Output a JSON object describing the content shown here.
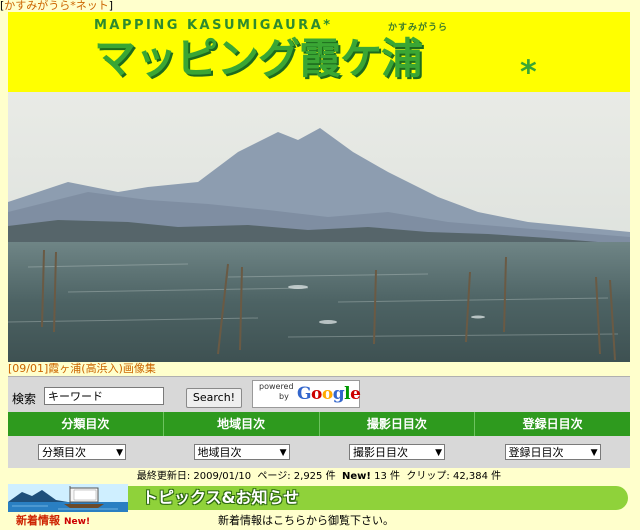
{
  "top_link": {
    "open": "[",
    "text": "かすみがうら*ネット",
    "close": "]"
  },
  "banner": {
    "title_en": "MAPPING KASUMIGAURA*",
    "title_jp": "マッピング霞ケ浦",
    "ruby": "かすみがうら",
    "asterisk": "*"
  },
  "photo_caption": {
    "text": "[09/01]霞ヶ浦(高浜入)画像集"
  },
  "search": {
    "label": "検索",
    "keyword_value": "キーワード",
    "button_label": "Search!",
    "google_powered": "powered",
    "google_by": "by",
    "google_logo": "Google",
    "google_colors": [
      "#3366cc",
      "#cc0000",
      "#ffaa00",
      "#3366cc",
      "#009900",
      "#cc0000"
    ]
  },
  "nav": {
    "headers": [
      "分類目次",
      "地域目次",
      "撮影日目次",
      "登録日目次"
    ],
    "selects": [
      "分類目次",
      "地域目次",
      "撮影日目次",
      "登録日目次"
    ],
    "arrow": "▼"
  },
  "stats": {
    "updated_label": "最終更新日:",
    "updated_date": "2009/01/10",
    "pages_label": "ページ:",
    "pages_value": "2,925",
    "pages_unit": "件",
    "new_label": "New!",
    "new_value": "13",
    "new_unit": "件",
    "clips_label": "クリップ:",
    "clips_value": "42,384",
    "clips_unit": "件"
  },
  "topics": {
    "title": "トピックス&お知らせ"
  },
  "news": {
    "heading": "新着情報",
    "new_badge": "New!",
    "message": "新着情報はこちらから御覧下さい。"
  },
  "colors": {
    "page_bg": "#ffffcc",
    "banner_bg": "#ffff00",
    "nav_green": "#2e9a1e",
    "link": "#cc6600",
    "topics_green": "#8fd23a"
  }
}
